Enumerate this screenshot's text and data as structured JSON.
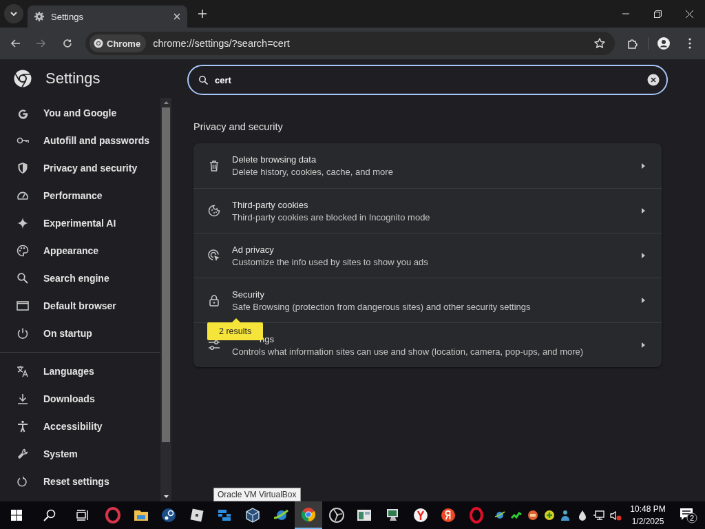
{
  "tab": {
    "title": "Settings"
  },
  "toolbar": {
    "chip": "Chrome",
    "url": "chrome://settings/?search=cert"
  },
  "header": {
    "title": "Settings"
  },
  "search": {
    "value": "cert"
  },
  "sidebar": {
    "groups": [
      [
        {
          "label": "You and Google"
        },
        {
          "label": "Autofill and passwords"
        },
        {
          "label": "Privacy and security"
        },
        {
          "label": "Performance"
        },
        {
          "label": "Experimental AI"
        },
        {
          "label": "Appearance"
        },
        {
          "label": "Search engine"
        },
        {
          "label": "Default browser"
        },
        {
          "label": "On startup"
        }
      ],
      [
        {
          "label": "Languages"
        },
        {
          "label": "Downloads"
        },
        {
          "label": "Accessibility"
        },
        {
          "label": "System"
        },
        {
          "label": "Reset settings"
        }
      ]
    ]
  },
  "section": {
    "title": "Privacy and security",
    "rows": [
      {
        "title": "Delete browsing data",
        "subtitle": "Delete history, cookies, cache, and more"
      },
      {
        "title": "Third-party cookies",
        "subtitle": "Third-party cookies are blocked in Incognito mode"
      },
      {
        "title": "Ad privacy",
        "subtitle": "Customize the info used by sites to show you ads"
      },
      {
        "title": "Security",
        "subtitle": "Safe Browsing (protection from dangerous sites) and other security settings"
      },
      {
        "title": "ngs",
        "covered": true,
        "subtitle": "Controls what information sites can use and show (location, camera, pop-ups, and more)"
      }
    ]
  },
  "results_bubble": {
    "text": "2 results"
  },
  "taskbar": {
    "tooltip": "Oracle VM VirtualBox",
    "apps": [
      {
        "selected": false
      },
      {
        "selected": false
      },
      {
        "selected": false
      },
      {
        "selected": false
      },
      {
        "selected": false
      },
      {
        "selected": false
      },
      {
        "selected": false
      },
      {
        "selected": true
      },
      {
        "selected": false
      },
      {
        "selected": false
      },
      {
        "selected": false
      },
      {
        "selected": false
      },
      {
        "selected": false
      },
      {
        "selected": false
      }
    ],
    "time": "10:48 PM",
    "date": "1/2/2025",
    "notifications": "2"
  }
}
